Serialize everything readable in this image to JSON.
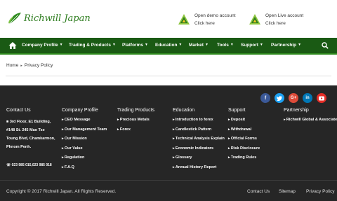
{
  "brand": {
    "logo_text": "Richwill Japan",
    "green": "#1a5a14",
    "accent": "#2f8a1f"
  },
  "header": {
    "demo": {
      "line1": "Open demo account",
      "line2": "Click here",
      "icon": "triangle-logo-icon"
    },
    "live": {
      "line1": "Open Live account",
      "line2": "Click here",
      "icon": "triangle-logo-icon"
    }
  },
  "nav": {
    "items": [
      {
        "label": "Company Profile"
      },
      {
        "label": "Trading & Products"
      },
      {
        "label": "Platforms"
      },
      {
        "label": "Education"
      },
      {
        "label": "Market"
      },
      {
        "label": "Tools"
      },
      {
        "label": "Support"
      },
      {
        "label": "Partnership"
      }
    ]
  },
  "breadcrumb": {
    "home": "Home",
    "current": "Privacy Policy"
  },
  "footer": {
    "social": [
      "facebook-icon",
      "twitter-icon",
      "google-plus-icon",
      "linkedin-icon",
      "youtube-icon"
    ],
    "contact": {
      "title": "Contact Us",
      "address": "3rd Floor, E1 Building, #148 St. 245 Mao Tse Toung Blvd, Chamkarmon, Phnom Penh.",
      "phone": "023 985 015,023 985 018"
    },
    "columns": [
      {
        "title": "Company Profile",
        "items": [
          "CEO Message",
          "Our Management Team",
          "Our Mission",
          "Our Value",
          "Regulation",
          "F.A.Q"
        ]
      },
      {
        "title": "Trading Products",
        "items": [
          "Precious Metals",
          "Forex"
        ]
      },
      {
        "title": "Education",
        "items": [
          "Introduction to forex",
          "Candlestick Pattern",
          "Technical Analysis Explain",
          "Economic Indicators",
          "Glossary",
          "Annual History Report"
        ]
      },
      {
        "title": "Support",
        "items": [
          "Deposit",
          "Withdrawal",
          "Official Forms",
          "Risk Disclosure",
          "Trading Rules"
        ]
      },
      {
        "title": "Partnership",
        "items": [
          "Richwill Global & Associate"
        ]
      }
    ],
    "copyright": "Copyright © 2017 Richwill Japan. All Rights Reserved.",
    "links": [
      "Contact Us",
      "Sitemap",
      "Privacy Policy"
    ]
  }
}
